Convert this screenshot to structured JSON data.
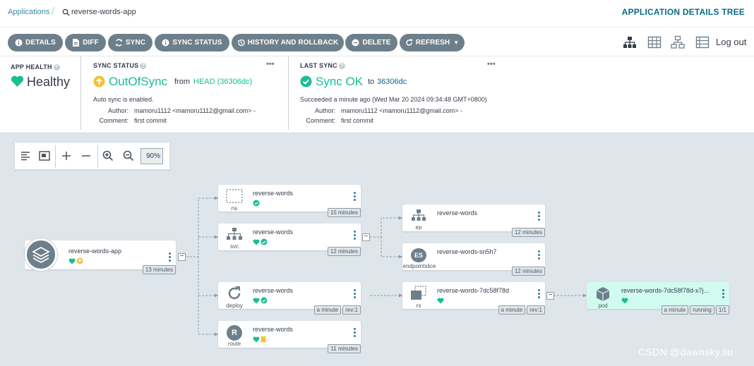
{
  "breadcrumb": {
    "root": "Applications",
    "app": "reverse-words-app"
  },
  "view_title": "APPLICATION DETAILS TREE",
  "toolbar": {
    "buttons": [
      "DETAILS",
      "DIFF",
      "SYNC",
      "SYNC STATUS",
      "HISTORY AND ROLLBACK",
      "DELETE",
      "REFRESH"
    ],
    "logout": "Log out"
  },
  "health": {
    "label": "APP HEALTH",
    "value": "Healthy"
  },
  "sync_status": {
    "label": "SYNC STATUS",
    "value": "OutOfSync",
    "from_text": "from",
    "ref": "HEAD (36306dc)",
    "auto_sync": "Auto sync is enabled.",
    "author_label": "Author:",
    "author": "mamoru1112 <mamoru1112@gmail.com> -",
    "comment_label": "Comment:",
    "comment": "first commit",
    "more": "•••"
  },
  "last_sync": {
    "label": "LAST SYNC",
    "value": "Sync OK",
    "to_text": "to",
    "revision": "36306dc",
    "succeeded": "Succeeded a minute ago (Wed Mar 20 2024 09:34:48 GMT+0800)",
    "author_label": "Author:",
    "author": "mamoru1112 <mamoru1112@gmail.com> -",
    "comment_label": "Comment:",
    "comment": "first commit",
    "more": "•••"
  },
  "zoom": {
    "value": "90%"
  },
  "app_node": {
    "name": "reverse-words-app",
    "age": "13 minutes"
  },
  "nodes": {
    "ns": {
      "name": "reverse-words",
      "kind": "ns",
      "age": "15 minutes"
    },
    "svc": {
      "name": "reverse-words",
      "kind": "svc",
      "age": "12 minutes"
    },
    "deploy": {
      "name": "reverse-words",
      "kind": "deploy",
      "age": "a minute",
      "rev": "rev:1"
    },
    "route": {
      "name": "reverse-words",
      "kind": "route",
      "age": "11 minutes"
    },
    "ep": {
      "name": "reverse-words",
      "kind": "ep",
      "age": "12 minutes"
    },
    "endpointslice": {
      "name": "reverse-words-sn5h7",
      "kind": "endpointslice",
      "icon_text": "ES",
      "age": "12 minutes"
    },
    "rs": {
      "name": "reverse-words-7dc58f78d",
      "kind": "rs",
      "age": "a minute",
      "rev": "rev:1"
    },
    "pod": {
      "name": "reverse-words-7dc58f78d-x7j...",
      "kind": "pod",
      "age": "a minute",
      "state": "running",
      "ready": "1/1"
    }
  },
  "route_icon_text": "R",
  "colors": {
    "healthy": "#18be94",
    "outofsync": "#f4c030",
    "button": "#6d7f8b",
    "link": "#0b6a8a"
  },
  "watermark": "CSDN @dawnsky.liu"
}
